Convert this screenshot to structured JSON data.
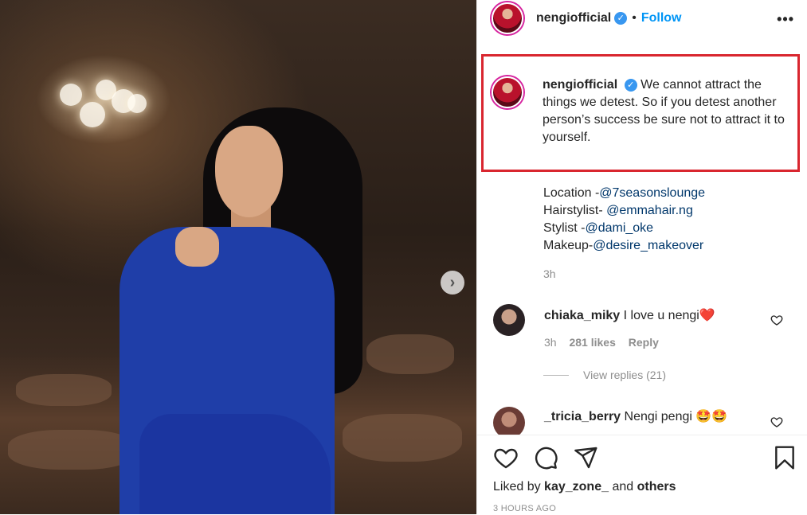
{
  "post": {
    "author": "nengiofficial",
    "follow_label": "Follow",
    "more_label": "•••",
    "dot": "•",
    "carousel_next": "›"
  },
  "caption": {
    "username": "nengiofficial",
    "text": "We cannot attract the things we detest. So if you detest another person’s success be sure not to attract it to yourself.",
    "credits": [
      {
        "label": "Location -",
        "mention": "@7seasonslounge"
      },
      {
        "label": "Hairstylist- ",
        "mention": "@emmahair.ng"
      },
      {
        "label": "Stylist -",
        "mention": "@dami_oke"
      },
      {
        "label": "Makeup-",
        "mention": "@desire_makeover"
      }
    ],
    "time": "3h"
  },
  "comments": [
    {
      "username": "chiaka_miky",
      "text": "I love u nengi",
      "emoji": "❤️",
      "time": "3h",
      "likes": "281 likes",
      "reply": "Reply"
    },
    {
      "username": "_tricia_berry",
      "text": "Nengi pengi",
      "emoji": "🤩🤩"
    }
  ],
  "view_replies": "View replies (21)",
  "footer": {
    "liked_prefix": "Liked by",
    "liked_user": "kay_zone_",
    "liked_and": "and",
    "liked_others": "others",
    "time_ago": "3 HOURS AGO"
  },
  "colors": {
    "accent": "#0095f6",
    "highlight_border": "#d9262f",
    "like_red": "#ed4956"
  }
}
